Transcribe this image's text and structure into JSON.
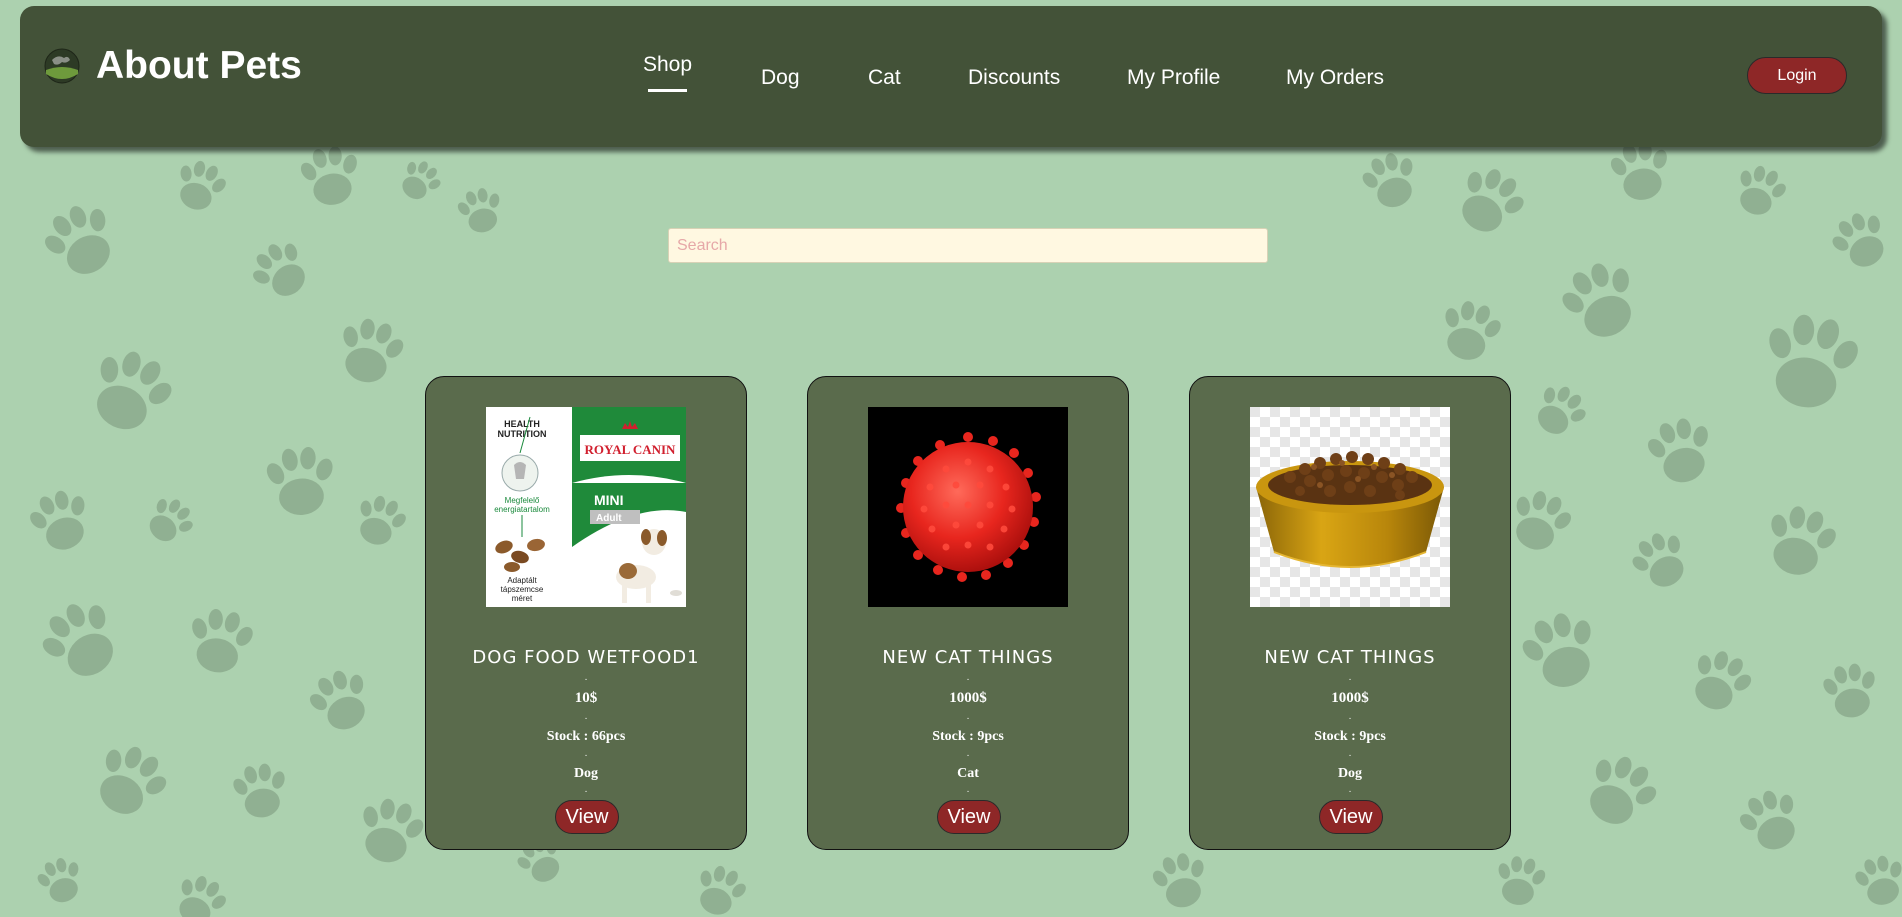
{
  "navbar": {
    "brand_title": "About Pets",
    "items": [
      {
        "label": "Shop"
      },
      {
        "label": "Dog"
      },
      {
        "label": "Cat"
      },
      {
        "label": "Discounts"
      },
      {
        "label": "My Profile"
      },
      {
        "label": "My Orders"
      }
    ],
    "active_item": "Shop",
    "login_label": "Login"
  },
  "search": {
    "placeholder": "Search",
    "value": ""
  },
  "products": [
    {
      "title": "DOG FOOD WETFOOD1",
      "price": "10$",
      "stock": "Stock : 66pcs",
      "category": "Dog",
      "view_label": "View",
      "image": "dog-food-bag"
    },
    {
      "title": "NEW CAT THINGS",
      "price": "1000$",
      "stock": "Stock : 9pcs",
      "category": "Cat",
      "view_label": "View",
      "image": "red-spiky-ball"
    },
    {
      "title": "NEW CAT THINGS",
      "price": "1000$",
      "stock": "Stock : 9pcs",
      "category": "Dog",
      "view_label": "View",
      "image": "food-bowl"
    }
  ],
  "product_image_text": {
    "health_line1": "HEALTH",
    "health_line2": "NUTRITION",
    "brand": "ROYAL CANIN",
    "variant": "MINI",
    "variant_sub": "Adult",
    "claim_line1": "Megfelelő",
    "claim_line2": "energiatartalom",
    "size_line1": "Adaptált",
    "size_line2": "tápszemcse",
    "size_line3": "méret"
  },
  "colors": {
    "page_bg": "#acd1af",
    "navbar_bg": "#435238",
    "card_bg": "#5a6b4c",
    "button_red": "#8e2727",
    "search_bg": "#fff8e1"
  }
}
